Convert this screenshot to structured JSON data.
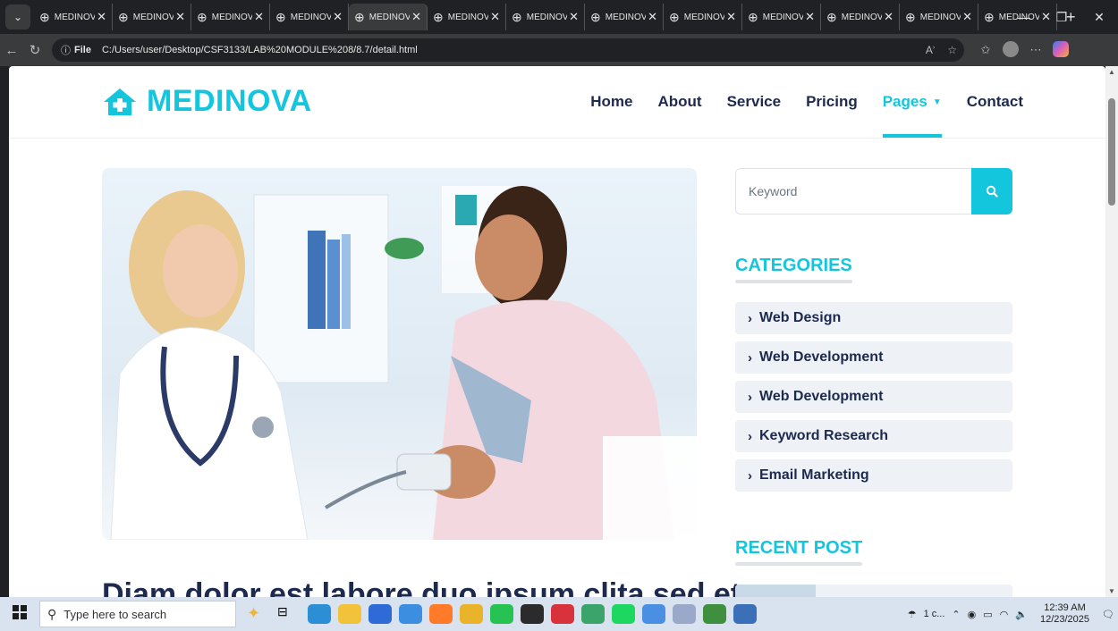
{
  "browser": {
    "tab_title": "MEDINOVA",
    "tab_count": 13,
    "active_tab_index": 4,
    "file_label": "File",
    "url": "C:/Users/user/Desktop/CSF3133/LAB%20MODULE%208/8.7/detail.html"
  },
  "site": {
    "brand": "MEDINOVA",
    "colors": {
      "primary": "#13c5dd",
      "dark": "#1d2a4d",
      "light": "#eef2f7"
    },
    "nav": [
      {
        "label": "Home"
      },
      {
        "label": "About"
      },
      {
        "label": "Service"
      },
      {
        "label": "Pricing"
      },
      {
        "label": "Pages",
        "active": true,
        "dropdown": true
      },
      {
        "label": "Contact"
      }
    ]
  },
  "post": {
    "title": "Diam dolor est labore duo ipsum clita sed et"
  },
  "sidebar": {
    "search_placeholder": "Keyword",
    "categories_title": "CATEGORIES",
    "categories": [
      "Web Design",
      "Web Development",
      "Web Development",
      "Keyword Research",
      "Email Marketing"
    ],
    "recent_title": "RECENT POST"
  },
  "taskbar": {
    "search_placeholder": "Type here to search",
    "weather": "1 c...",
    "time": "12:39 AM",
    "date": "12/23/2025"
  }
}
